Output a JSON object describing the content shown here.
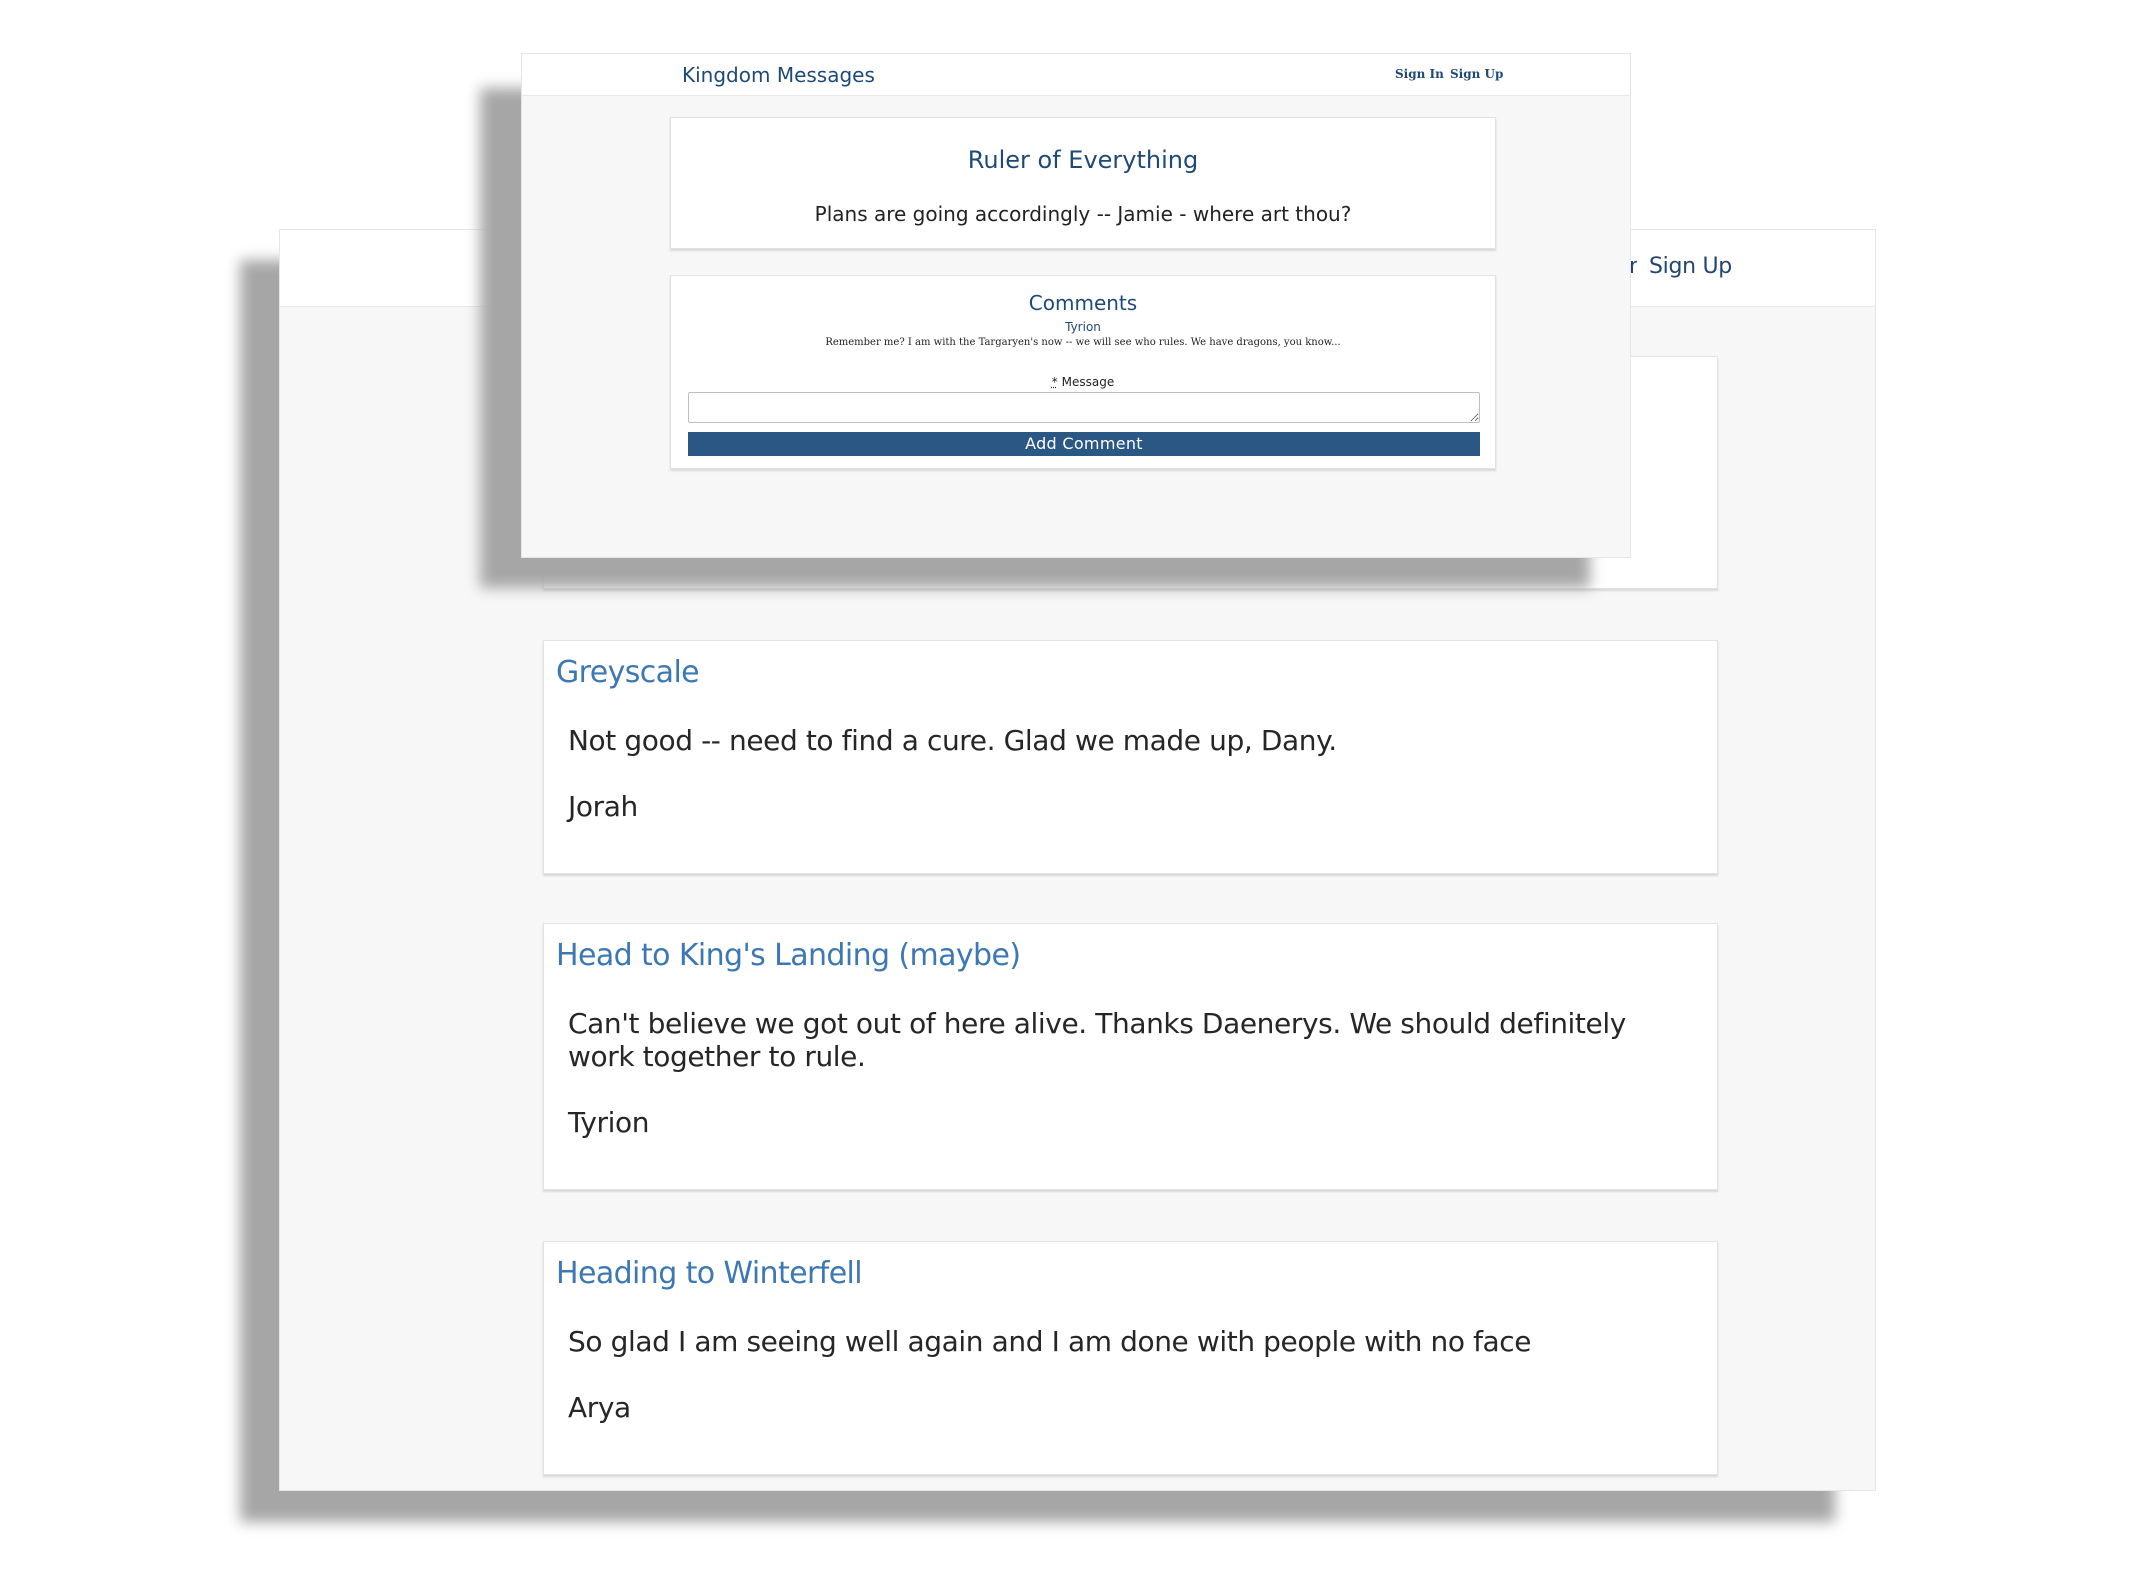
{
  "back": {
    "header": {
      "signin_fragment": "n",
      "signup_label": "Sign Up"
    },
    "posts": [
      {
        "title": "Greyscale",
        "body": "Not good -- need to find a cure. Glad we made up, Dany.",
        "author": "Jorah"
      },
      {
        "title": "Head to King's Landing (maybe)",
        "body": "Can't believe we got out of here alive. Thanks Daenerys. We should definitely work together to rule.",
        "author": "Tyrion"
      },
      {
        "title": "Heading to Winterfell",
        "body": "So glad I am seeing well again and I am done with people with no face",
        "author": "Arya"
      }
    ]
  },
  "front": {
    "header": {
      "brand": "Kingdom Messages",
      "signin_label": "Sign In",
      "signup_label": "Sign Up"
    },
    "post": {
      "title": "Ruler of Everything",
      "body": "Plans are going accordingly -- Jamie - where art thou?"
    },
    "comments": {
      "heading": "Comments",
      "items": [
        {
          "author": "Tyrion",
          "text": "Remember me? I am with the Targaryen's now -- we will see who rules. We have dragons, you know..."
        }
      ],
      "form": {
        "required_marker": "*",
        "message_label": "Message",
        "message_value": "",
        "submit_label": "Add Comment"
      }
    }
  },
  "colors": {
    "brand": "#1f4a78",
    "post_title": "#3d78b2",
    "button": "#2b5784"
  }
}
